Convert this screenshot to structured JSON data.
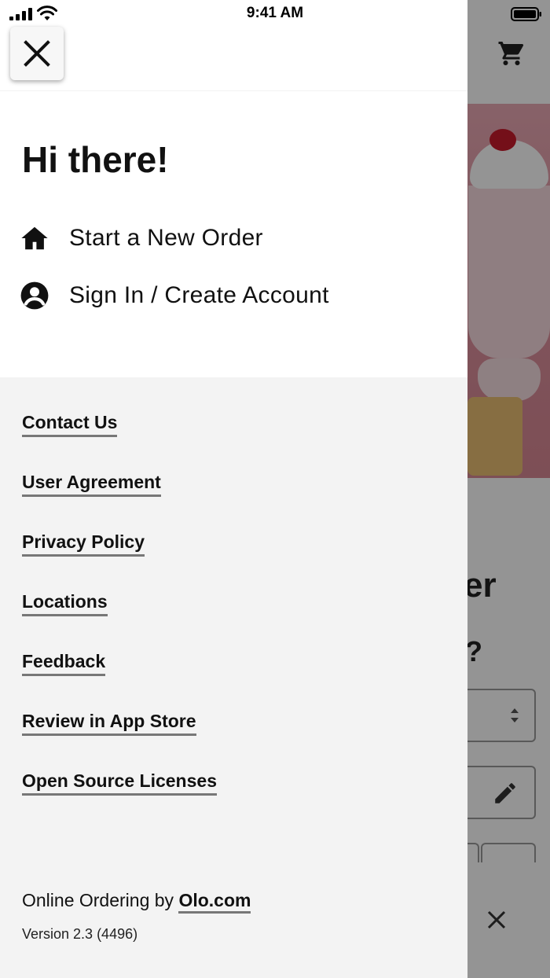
{
  "status_bar": {
    "time": "9:41 AM"
  },
  "drawer": {
    "greeting": "Hi there!",
    "menu": [
      {
        "label": "Start a New Order",
        "icon": "home-icon"
      },
      {
        "label": "Sign In / Create Account",
        "icon": "account-circle-icon"
      }
    ],
    "links": [
      "Contact Us",
      "User Agreement",
      "Privacy Policy",
      "Locations",
      "Feedback",
      "Review in App Store",
      "Open Source Licenses"
    ],
    "footer": {
      "prefix": "Online Ordering by ",
      "link": "Olo.com",
      "version": "Version 2.3 (4496)"
    }
  },
  "background": {
    "title_fragment": "er",
    "question_fragment": "?"
  },
  "colors": {
    "drawer_bg": "#f3f3f3",
    "overlay": "#00000066",
    "text": "#111111",
    "underline": "#777777"
  }
}
